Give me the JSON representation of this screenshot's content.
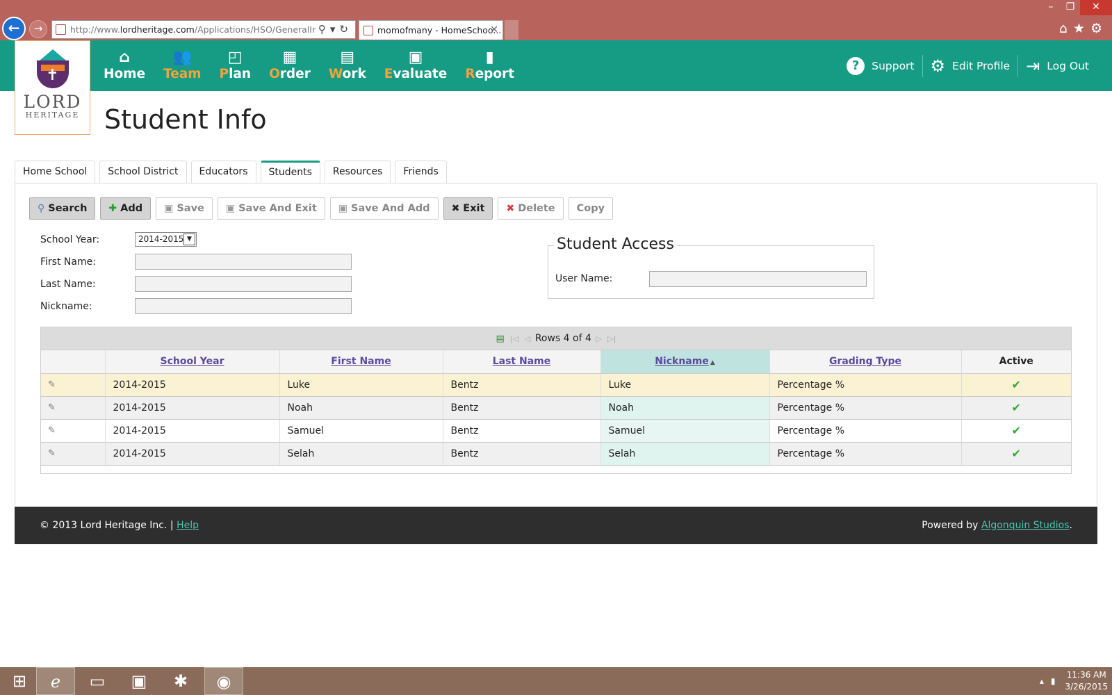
{
  "browser": {
    "address_prefix": "http://www.",
    "address_host": "lordheritage.com",
    "address_path": "/Applications/HSO/GeneralInfo/S",
    "tab_title": "momofmany - HomeSchoo..."
  },
  "site": {
    "logo_line1": "LORD",
    "logo_line2": "HERITAGE",
    "nav": [
      {
        "first": "",
        "rest": "Home",
        "icon": "house-icon"
      },
      {
        "first": "T",
        "rest": "eam",
        "icon": "team-icon"
      },
      {
        "first": "P",
        "rest": "lan",
        "icon": "plan-icon"
      },
      {
        "first": "O",
        "rest": "rder",
        "icon": "order-icon"
      },
      {
        "first": "W",
        "rest": "ork",
        "icon": "work-icon"
      },
      {
        "first": "E",
        "rest": "valuate",
        "icon": "evaluate-icon"
      },
      {
        "first": "R",
        "rest": "eport",
        "icon": "report-icon"
      }
    ],
    "right_nav": {
      "support": "Support",
      "edit_profile": "Edit Profile",
      "log_out": "Log Out"
    },
    "accent": "#169c84",
    "highlight": "#f2a33a"
  },
  "page": {
    "title": "Student Info",
    "tabs": [
      "Home School",
      "School District",
      "Educators",
      "Students",
      "Resources",
      "Friends"
    ],
    "active_tab": "Students"
  },
  "toolbar": {
    "search": "Search",
    "add": "Add",
    "save": "Save",
    "save_and_exit": "Save And Exit",
    "save_and_add": "Save And Add",
    "exit": "Exit",
    "delete": "Delete",
    "copy": "Copy"
  },
  "form": {
    "school_year_label": "School Year:",
    "school_year_value": "2014-2015",
    "first_name_label": "First Name:",
    "first_name_value": "",
    "last_name_label": "Last Name:",
    "last_name_value": "",
    "nickname_label": "Nickname:",
    "nickname_value": ""
  },
  "student_access": {
    "legend": "Student Access",
    "user_name_label": "User Name:",
    "user_name_value": ""
  },
  "grid": {
    "pager_text": "Rows 4 of 4",
    "columns": [
      "School Year",
      "First Name",
      "Last Name",
      "Nickname",
      "Grading Type",
      "Active"
    ],
    "sorted_column": "Nickname",
    "sort_direction": "ascending",
    "rows": [
      {
        "school_year": "2014-2015",
        "first_name": "Luke",
        "last_name": "Bentz",
        "nickname": "Luke",
        "grading_type": "Percentage %",
        "active": "✔"
      },
      {
        "school_year": "2014-2015",
        "first_name": "Noah",
        "last_name": "Bentz",
        "nickname": "Noah",
        "grading_type": "Percentage %",
        "active": "✔"
      },
      {
        "school_year": "2014-2015",
        "first_name": "Samuel",
        "last_name": "Bentz",
        "nickname": "Samuel",
        "grading_type": "Percentage %",
        "active": "✔"
      },
      {
        "school_year": "2014-2015",
        "first_name": "Selah",
        "last_name": "Bentz",
        "nickname": "Selah",
        "grading_type": "Percentage %",
        "active": "✔"
      }
    ]
  },
  "footer": {
    "copyright": "© 2013 Lord Heritage Inc.  |",
    "help": "Help",
    "powered_by": "Powered by",
    "studio": "Algonquin Studios",
    "period": "."
  },
  "taskbar": {
    "time": "11:36 AM",
    "date": "3/26/2015"
  }
}
